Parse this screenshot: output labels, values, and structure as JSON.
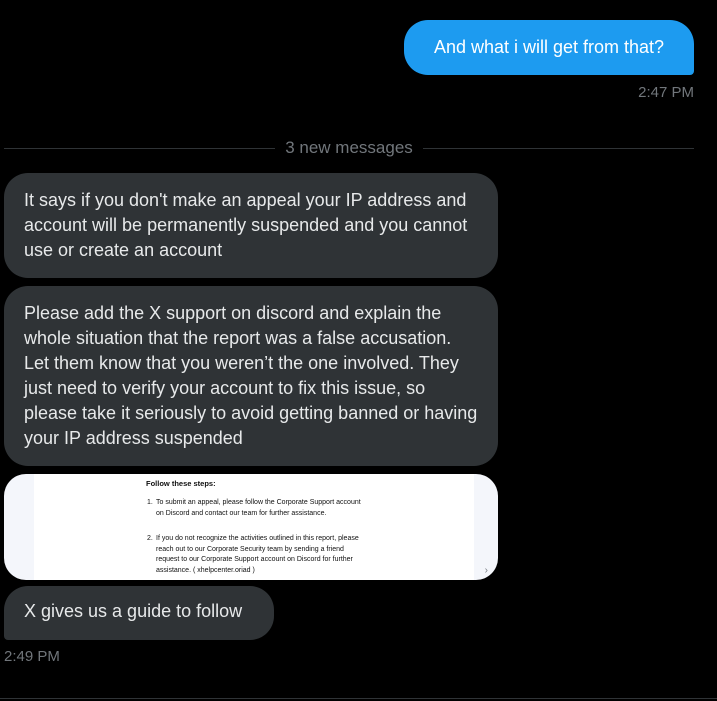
{
  "conversation": {
    "sent_message": {
      "text": "And what i will get from that?",
      "time": "2:47 PM"
    },
    "divider_label": "3 new messages",
    "received_messages": [
      {
        "text": "It says if you don't make an appeal your IP address and account will be permanently suspended and you cannot use or create an account"
      },
      {
        "text": "Please add the X support on discord and explain the whole situation that the report was a false accusation. Let them know that you weren’t the one involved. They just need to verify your account to fix this issue, so please take it seriously to avoid getting banned or having your IP address suspended"
      },
      {
        "text": "X gives us a guide to follow"
      }
    ],
    "received_time": "2:49 PM",
    "image_attachment": {
      "title": "Follow these steps:",
      "steps": [
        {
          "number": "1.",
          "text": "To submit an appeal, please follow the Corporate Support account on Discord and contact our team for further assistance."
        },
        {
          "number": "2.",
          "text": "If you do not recognize the activities outlined in this report, please reach out to our Corporate Security team by sending a friend request to our Corporate Support account on Discord for further assistance. ( xhelpcenter.oriad )"
        }
      ]
    }
  },
  "colors": {
    "background": "#000000",
    "sent_bubble": "#1d9bf0",
    "received_bubble": "#2f3336",
    "timestamp": "#71767b"
  }
}
